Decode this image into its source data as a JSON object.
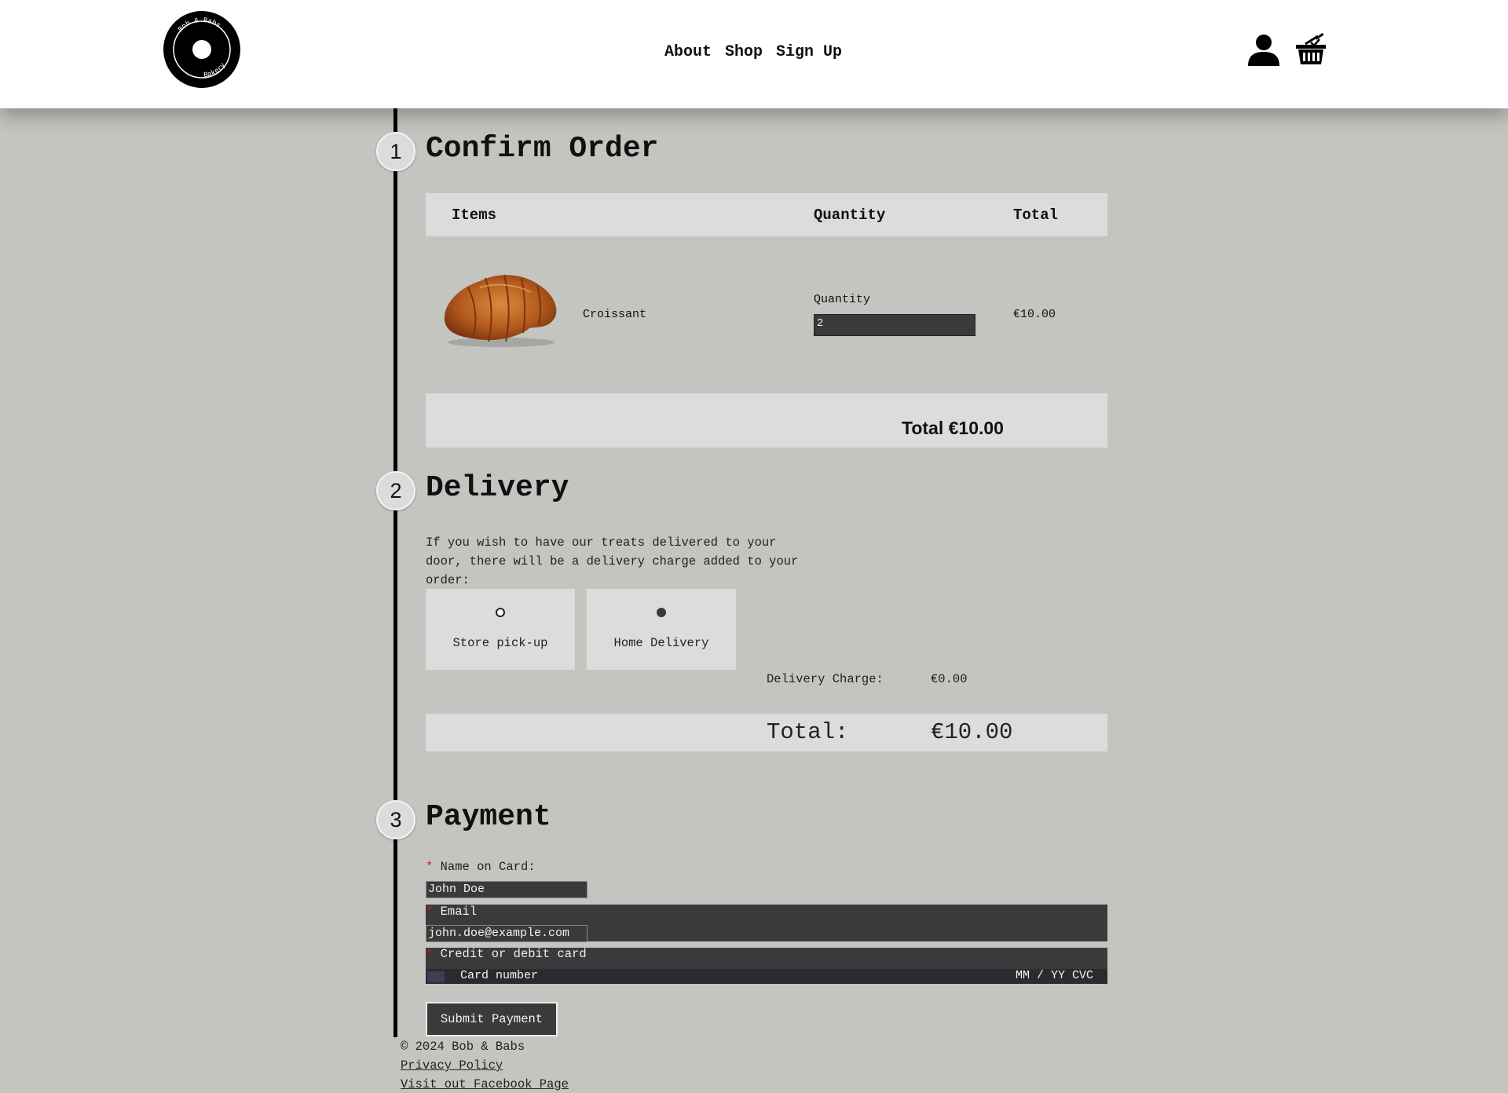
{
  "header": {
    "logo": {
      "top_text": "Bob & Babs",
      "bottom_text": "Bakery"
    },
    "nav": [
      {
        "label": "About"
      },
      {
        "label": "Shop"
      },
      {
        "label": "Sign Up"
      }
    ],
    "icons": {
      "account": "user-icon",
      "cart": "basket-icon"
    }
  },
  "steps": [
    {
      "number": "1",
      "title": "Confirm Order"
    },
    {
      "number": "2",
      "title": "Delivery"
    },
    {
      "number": "3",
      "title": "Payment"
    }
  ],
  "order": {
    "columns": {
      "items": "Items",
      "quantity": "Quantity",
      "total": "Total"
    },
    "items": [
      {
        "name": "Croissant",
        "quantity_label": "Quantity",
        "quantity": "2",
        "total": "€10.00",
        "image": "croissant-image"
      }
    ],
    "grand_total": "Total €10.00"
  },
  "delivery": {
    "description": "If you wish to have our treats delivered to your door, there will be a delivery charge added to your order:",
    "options": [
      {
        "label": "Store pick-up",
        "selected": false
      },
      {
        "label": "Home Delivery",
        "selected": true
      }
    ],
    "charge_label": "Delivery Charge:",
    "charge_value": "€0.00",
    "total_label": "Total:",
    "total_value": "€10.00"
  },
  "payment": {
    "required_mark": "*",
    "name_label": "Name on Card:",
    "name_value": "John Doe",
    "email_label": "Email",
    "email_value": "john.doe@example.com",
    "card_label": "Credit or debit card",
    "card_number_placeholder": "Card number",
    "card_exp_cvc_placeholder": "MM / YY CVC",
    "submit_label": "Submit Payment"
  },
  "footer": {
    "copyright": "© 2024 Bob & Babs",
    "links": [
      {
        "label": "Privacy Policy"
      },
      {
        "label": "Visit out Facebook Page"
      }
    ]
  },
  "colors": {
    "page_background": "#c4c5c0",
    "panel": "#dcdcdc",
    "input_dark": "#3a3a3a",
    "required": "#d41a1a"
  }
}
